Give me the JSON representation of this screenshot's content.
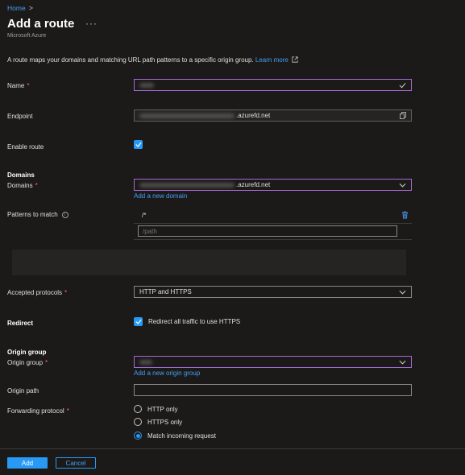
{
  "breadcrumb": {
    "home": "Home",
    "separator": ">"
  },
  "header": {
    "title": "Add a route",
    "more": "···",
    "subtitle": "Microsoft Azure"
  },
  "description": {
    "text": "A route maps your domains and matching URL path patterns to a specific origin group.",
    "learn_more": "Learn more"
  },
  "form": {
    "name": {
      "label": "Name",
      "required": "*",
      "value": ""
    },
    "endpoint": {
      "label": "Endpoint",
      "value_suffix": ".azurefd.net"
    },
    "enable_route": {
      "label": "Enable route",
      "checked": true
    },
    "domains_section": "Domains",
    "domains": {
      "label": "Domains",
      "required": "*",
      "value_suffix": ".azurefd.net",
      "add_link": "Add a new domain"
    },
    "patterns": {
      "label": "Patterns to match",
      "existing": "/*",
      "placeholder": "/path"
    },
    "protocols": {
      "label": "Accepted protocols",
      "required": "*",
      "value": "HTTP and HTTPS"
    },
    "redirect": {
      "label": "Redirect",
      "checkbox_label": "Redirect all traffic to use HTTPS",
      "checked": true
    },
    "origin_section": "Origin group",
    "origin_group": {
      "label": "Origin group",
      "required": "*",
      "value": "",
      "add_link": "Add a new origin group"
    },
    "origin_path": {
      "label": "Origin path",
      "value": ""
    },
    "forwarding": {
      "label": "Forwarding protocol",
      "required": "*",
      "options": [
        "HTTP only",
        "HTTPS only",
        "Match incoming request"
      ],
      "selected": "Match incoming request"
    }
  },
  "footer": {
    "add": "Add",
    "cancel": "Cancel"
  },
  "colors": {
    "accent": "#2899f5",
    "link": "#479ef5",
    "valid_border": "#a56ad4",
    "background": "#1b1a19"
  }
}
